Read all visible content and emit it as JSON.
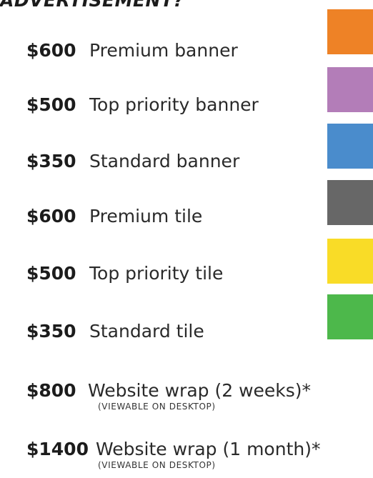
{
  "heading": "ADVERTISEMENT?",
  "options": [
    {
      "price": "$600",
      "label": "Premium banner"
    },
    {
      "price": "$500",
      "label": "Top priority banner"
    },
    {
      "price": "$350",
      "label": "Standard banner"
    },
    {
      "price": "$600",
      "label": "Premium tile"
    },
    {
      "price": "$500",
      "label": "Top priority tile"
    },
    {
      "price": "$350",
      "label": "Standard tile"
    },
    {
      "price": "$800",
      "label": "Website wrap (2 weeks)*",
      "note": "(VIEWABLE ON DESKTOP)"
    },
    {
      "price": "$1400",
      "label": "Website wrap (1 month)*",
      "note": "(VIEWABLE ON DESKTOP)"
    }
  ],
  "swatch_colors": {
    "premium_banner": "#ee8226",
    "top_priority_banner": "#b37db8",
    "standard_banner": "#4a8ccc",
    "premium_tile": "#676767",
    "top_priority_tile": "#f9dc27",
    "standard_tile": "#4db84b"
  }
}
